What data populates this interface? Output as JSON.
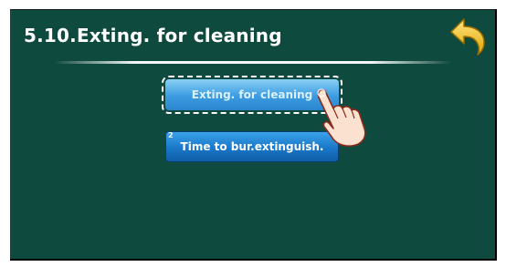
{
  "screen": {
    "title": "5.10.Exting. for cleaning",
    "back_icon": "undo-arrow-icon"
  },
  "menu": {
    "items": [
      {
        "label": "Exting. for cleaning",
        "number": "",
        "state": "selected"
      },
      {
        "label": "Time to bur.extinguish.",
        "number": "2",
        "state": "normal"
      }
    ]
  },
  "colors": {
    "background": "#0f4a3e",
    "button_selected": "#3b9be0",
    "button_normal": "#1a77c9",
    "back_arrow": "#f4c21a"
  }
}
